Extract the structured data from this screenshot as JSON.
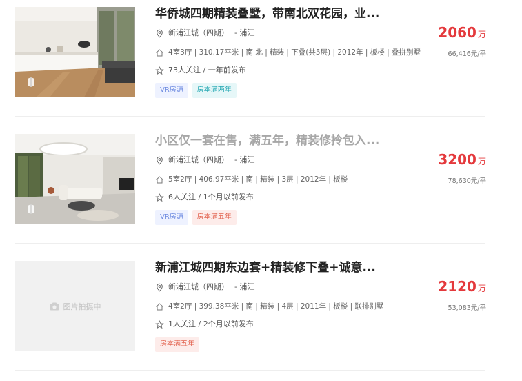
{
  "listings": [
    {
      "title": "华侨城四期精装叠墅，带南北双花园，业...",
      "community": "新浦江城（四期）",
      "district": "- 浦江",
      "info": "4室3厅 | 310.17平米 | 南 北 | 精装 | 下叠(共5层) | 2012年 | 板楼 | 叠拼别墅",
      "follow": "73人关注 / 一年前发布",
      "tags": [
        "VR房源",
        "房本满两年"
      ],
      "price": "2060",
      "price_unit": "万",
      "unit_price": "66,416元/平"
    },
    {
      "title": "小区仅一套在售，满五年，精装修拎包入...",
      "community": "新浦江城（四期）",
      "district": "- 浦江",
      "info": "5室2厅 | 406.97平米 | 南 | 精装 | 3层 | 2012年 | 板楼",
      "follow": "6人关注 / 1个月以前发布",
      "tags": [
        "VR房源",
        "房本满五年"
      ],
      "price": "3200",
      "price_unit": "万",
      "unit_price": "78,630元/平"
    },
    {
      "title": "新浦江城四期东边套+精装修下叠+诚意...",
      "community": "新浦江城（四期）",
      "district": "- 浦江",
      "info": "4室2厅 | 399.38平米 | 南 | 精装 | 4层 | 2011年 | 板楼 | 联排别墅",
      "follow": "1人关注 / 2个月以前发布",
      "tags": [
        "房本满五年"
      ],
      "price": "2120",
      "price_unit": "万",
      "unit_price": "53,083元/平",
      "image_placeholder": "图片拍摄中"
    }
  ],
  "colors": {
    "price": "#e4393c",
    "vr_tag": "#6d8be0",
    "teal_tag": "#27a9b4",
    "red_tag": "#e2614d"
  },
  "icons": [
    "location-pin-icon",
    "house-icon",
    "star-icon",
    "vr-icon",
    "camera-icon"
  ]
}
